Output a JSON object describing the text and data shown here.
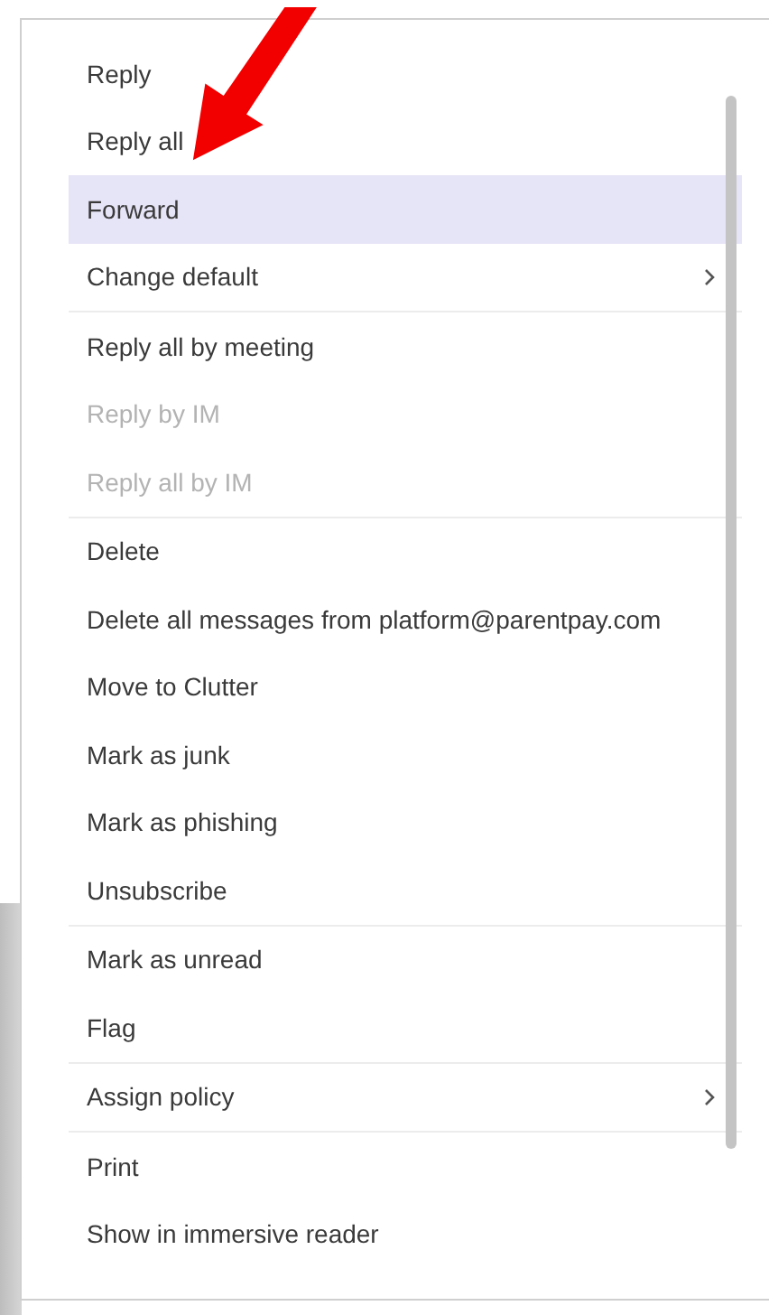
{
  "menu": {
    "groups": [
      {
        "items": [
          {
            "label": "Reply",
            "selected": false,
            "disabled": false,
            "submenu": false
          },
          {
            "label": "Reply all",
            "selected": false,
            "disabled": false,
            "submenu": false
          },
          {
            "label": "Forward",
            "selected": true,
            "disabled": false,
            "submenu": false
          },
          {
            "label": "Change default",
            "selected": false,
            "disabled": false,
            "submenu": true
          }
        ]
      },
      {
        "items": [
          {
            "label": "Reply all by meeting",
            "selected": false,
            "disabled": false,
            "submenu": false
          },
          {
            "label": "Reply by IM",
            "selected": false,
            "disabled": true,
            "submenu": false
          },
          {
            "label": "Reply all by IM",
            "selected": false,
            "disabled": true,
            "submenu": false
          }
        ]
      },
      {
        "items": [
          {
            "label": "Delete",
            "selected": false,
            "disabled": false,
            "submenu": false
          },
          {
            "label": "Delete all messages from platform@parentpay.com",
            "selected": false,
            "disabled": false,
            "submenu": false
          },
          {
            "label": "Move to Clutter",
            "selected": false,
            "disabled": false,
            "submenu": false
          },
          {
            "label": "Mark as junk",
            "selected": false,
            "disabled": false,
            "submenu": false
          },
          {
            "label": "Mark as phishing",
            "selected": false,
            "disabled": false,
            "submenu": false
          },
          {
            "label": "Unsubscribe",
            "selected": false,
            "disabled": false,
            "submenu": false
          }
        ]
      },
      {
        "items": [
          {
            "label": "Mark as unread",
            "selected": false,
            "disabled": false,
            "submenu": false
          },
          {
            "label": "Flag",
            "selected": false,
            "disabled": false,
            "submenu": false
          }
        ]
      },
      {
        "items": [
          {
            "label": "Assign policy",
            "selected": false,
            "disabled": false,
            "submenu": true
          }
        ]
      },
      {
        "items": [
          {
            "label": "Print",
            "selected": false,
            "disabled": false,
            "submenu": false
          },
          {
            "label": "Show in immersive reader",
            "selected": false,
            "disabled": false,
            "submenu": false
          }
        ]
      }
    ]
  }
}
